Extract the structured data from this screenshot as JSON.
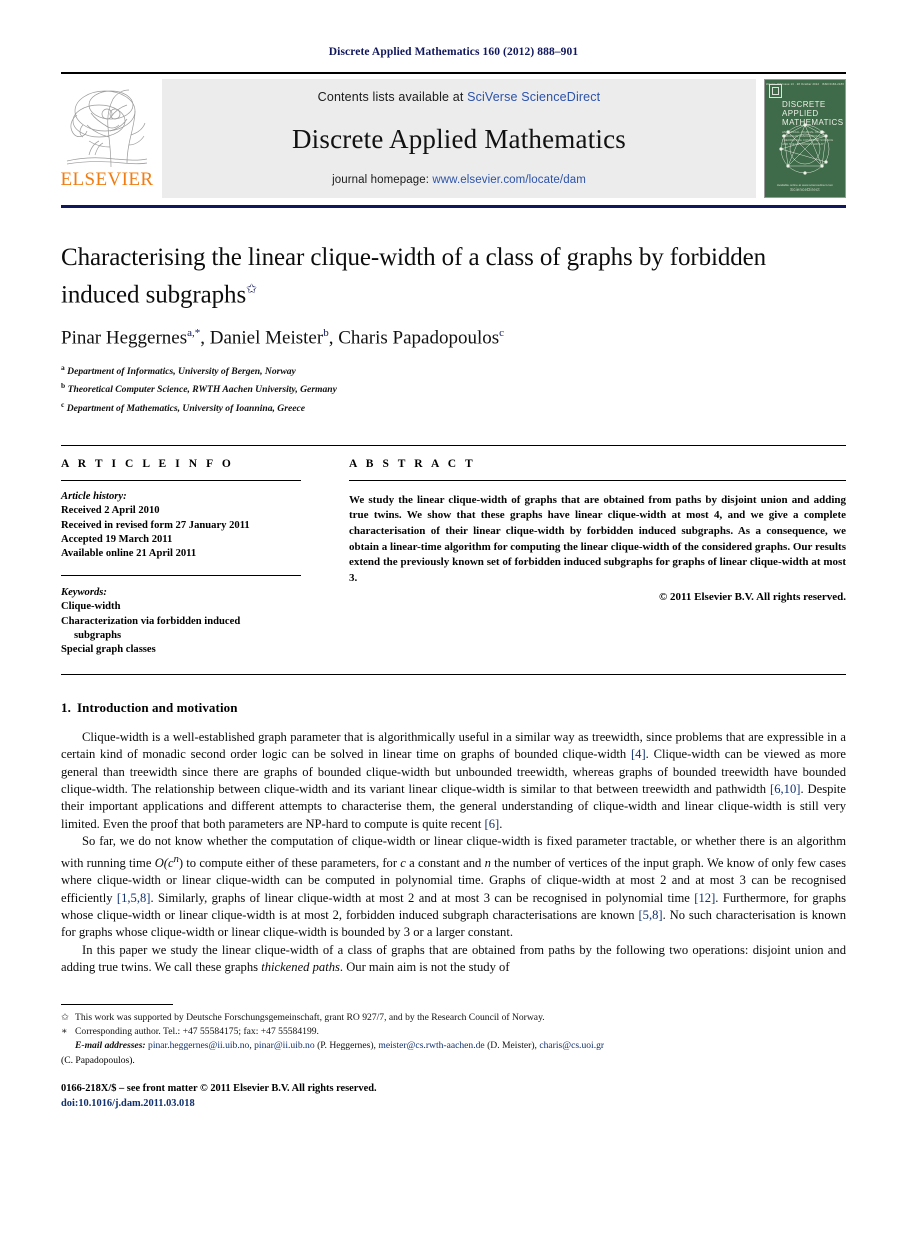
{
  "running_head": "Discrete Applied Mathematics 160 (2012) 888–901",
  "masthead": {
    "elsevier_wordmark": "ELSEVIER",
    "contents_prefix": "Contents lists available at ",
    "contents_link": "SciVerse ScienceDirect",
    "journal_title": "Discrete Applied Mathematics",
    "homepage_prefix": "journal homepage: ",
    "homepage_link": "www.elsevier.com/locate/dam",
    "cover": {
      "top_strip_left": "Volume 160  Issue 13 · 28 October 2012",
      "top_strip_right": "ISSN 0166-218X",
      "title_line1": "DISCRETE",
      "title_line2": "APPLIED",
      "title_line3": "MATHEMATICS",
      "subtitle": "AN OFFICIAL JOURNAL OF THE EUROPEAN ASSOCIATION FOR THEORETICAL COMPUTER SCIENCE AND THE NETWORKS GROUP",
      "footer_small": "Available online at www.sciencedirect.com",
      "footer_brand": "ScienceDirect"
    }
  },
  "article": {
    "title": "Characterising the linear clique-width of a class of graphs by forbidden induced subgraphs",
    "title_footnote_mark": "✩",
    "authors": [
      {
        "name": "Pinar Heggernes",
        "sup": "a,*"
      },
      {
        "name": "Daniel Meister",
        "sup": "b"
      },
      {
        "name": "Charis Papadopoulos",
        "sup": "c"
      }
    ],
    "affiliations": [
      {
        "mark": "a",
        "text": "Department of Informatics, University of Bergen, Norway"
      },
      {
        "mark": "b",
        "text": "Theoretical Computer Science, RWTH Aachen University, Germany"
      },
      {
        "mark": "c",
        "text": "Department of Mathematics, University of Ioannina, Greece"
      }
    ]
  },
  "info": {
    "heading": "A R T I C L E    I N F O",
    "history_label": "Article history:",
    "history": [
      "Received 2 April 2010",
      "Received in revised form 27 January 2011",
      "Accepted 19 March 2011",
      "Available online 21 April 2011"
    ],
    "keywords_label": "Keywords:",
    "keywords": [
      {
        "text": "Clique-width",
        "indent": false
      },
      {
        "text": "Characterization via forbidden induced",
        "indent": false
      },
      {
        "text": "subgraphs",
        "indent": true
      },
      {
        "text": "Special graph classes",
        "indent": false
      }
    ]
  },
  "abstract": {
    "heading": "A B S T R A C T",
    "text": "We study the linear clique-width of graphs that are obtained from paths by disjoint union and adding true twins. We show that these graphs have linear clique-width at most 4, and we give a complete characterisation of their linear clique-width by forbidden induced subgraphs. As a consequence, we obtain a linear-time algorithm for computing the linear clique-width of the considered graphs. Our results extend the previously known set of forbidden induced subgraphs for graphs of linear clique-width at most 3.",
    "copyright": "© 2011 Elsevier B.V. All rights reserved."
  },
  "body": {
    "section_number": "1.",
    "section_title": "Introduction and motivation",
    "paragraph1_a": "Clique-width is a well-established graph parameter that is algorithmically useful in a similar way as treewidth, since problems that are expressible in a certain kind of monadic second order logic can be solved in linear time on graphs of bounded clique-width ",
    "ref_4": "[4]",
    "paragraph1_b": ". Clique-width can be viewed as more general than treewidth since there are graphs of bounded clique-width but unbounded treewidth, whereas graphs of bounded treewidth have bounded clique-width. The relationship between clique-width and its variant linear clique-width is similar to that between treewidth and pathwidth ",
    "ref_6_10": "[6,10]",
    "paragraph1_c": ". Despite their important applications and different attempts to characterise them, the general understanding of clique-width and linear clique-width is still very limited. Even the proof that both parameters are NP-hard to compute is quite recent ",
    "ref_6": "[6]",
    "paragraph1_d": ".",
    "paragraph2_a": "So far, we do not know whether the computation of clique-width or linear clique-width is fixed parameter tractable, or whether there is an algorithm with running time ",
    "complexity": "O(c",
    "complexity_exp": "n",
    "complexity_close": ")",
    "paragraph2_b": " to compute either of these parameters, for ",
    "var_c": "c",
    "paragraph2_c": " a constant and ",
    "var_n": "n",
    "paragraph2_d": " the number of vertices of the input graph. We know of only few cases where clique-width or linear clique-width can be computed in polynomial time. Graphs of clique-width at most 2 and at most 3 can be recognised efficiently ",
    "ref_1_5_8": "[1,5,8]",
    "paragraph2_e": ". Similarly, graphs of linear clique-width at most 2 and at most 3 can be recognised in polynomial time ",
    "ref_12": "[12]",
    "paragraph2_f": ". Furthermore, for graphs whose clique-width or linear clique-width is at most 2, forbidden induced subgraph characterisations are known ",
    "ref_5_8": "[5,8]",
    "paragraph2_g": ". No such characterisation is known for graphs whose clique-width or linear clique-width is bounded by 3 or a larger constant.",
    "paragraph3_a": "In this paper we study the linear clique-width of a class of graphs that are obtained from paths by the following two operations: disjoint union and adding true twins. We call these graphs ",
    "paragraph3_italic": "thickened paths",
    "paragraph3_b": ". Our main aim is not the study of"
  },
  "footnotes": {
    "funding_mark": "✩",
    "funding": "This work was supported by Deutsche Forschungsgemeinschaft, grant RO 927/7, and by the Research Council of Norway.",
    "corresponding_mark": "∗",
    "corresponding": "Corresponding author. Tel.: +47 55584175; fax: +47 55584199.",
    "email_label": "E-mail addresses:",
    "emails": [
      {
        "address": "pinar.heggernes@ii.uib.no",
        "sep": ", "
      },
      {
        "address": "pinar@ii.uib.no",
        "sep": " "
      }
    ],
    "email_owner1": "(P. Heggernes),",
    "email2": "meister@cs.rwth-aachen.de",
    "email_owner2": "(D. Meister),",
    "email3": "charis@cs.uoi.gr",
    "email_owner3": "(C. Papadopoulos)."
  },
  "imprint": {
    "line1": "0166-218X/$ – see front matter © 2011 Elsevier B.V. All rights reserved.",
    "doi": "doi:10.1016/j.dam.2011.03.018"
  }
}
